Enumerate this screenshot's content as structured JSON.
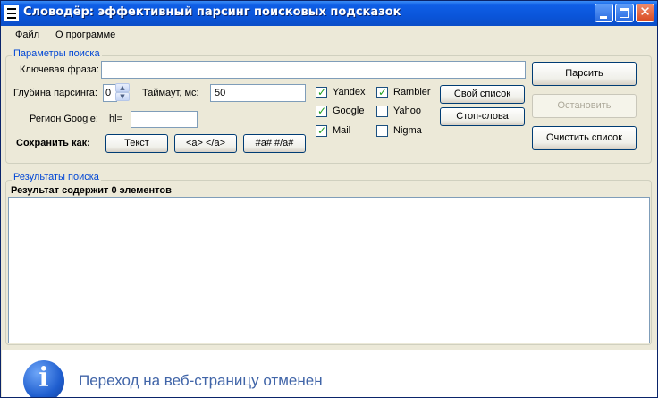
{
  "window": {
    "title": "Словодёр: эффективный парсинг поисковых подсказок"
  },
  "menu": {
    "file": "Файл",
    "about": "О программе"
  },
  "params": {
    "legend": "Параметры поиска",
    "keyword_label": "Ключевая фраза:",
    "keyword_value": "",
    "depth_label": "Глубина парсинга:",
    "depth_value": "0",
    "timeout_label": "Таймаут, мс:",
    "timeout_value": "50",
    "region_label": "Регион Google:",
    "hl_label": "hl=",
    "hl_value": "",
    "save_as_label": "Сохранить как:",
    "save_text": "Текст",
    "save_a": "<a> </a>",
    "save_hash": "#a# #/a#"
  },
  "engines": [
    {
      "name": "Yandex",
      "checked": true
    },
    {
      "name": "Google",
      "checked": true
    },
    {
      "name": "Mail",
      "checked": true
    },
    {
      "name": "Rambler",
      "checked": true
    },
    {
      "name": "Yahoo",
      "checked": false
    },
    {
      "name": "Nigma",
      "checked": false
    }
  ],
  "list_buttons": {
    "own_list": "Свой список",
    "stop_words": "Стоп-слова"
  },
  "actions": {
    "parse": "Парсить",
    "stop": "Остановить",
    "clear": "Очистить список"
  },
  "results": {
    "legend": "Результаты поиска",
    "count_text": "Результат содержит 0 элементов",
    "items": []
  },
  "status": {
    "message": "Переход на веб-страницу отменен"
  }
}
